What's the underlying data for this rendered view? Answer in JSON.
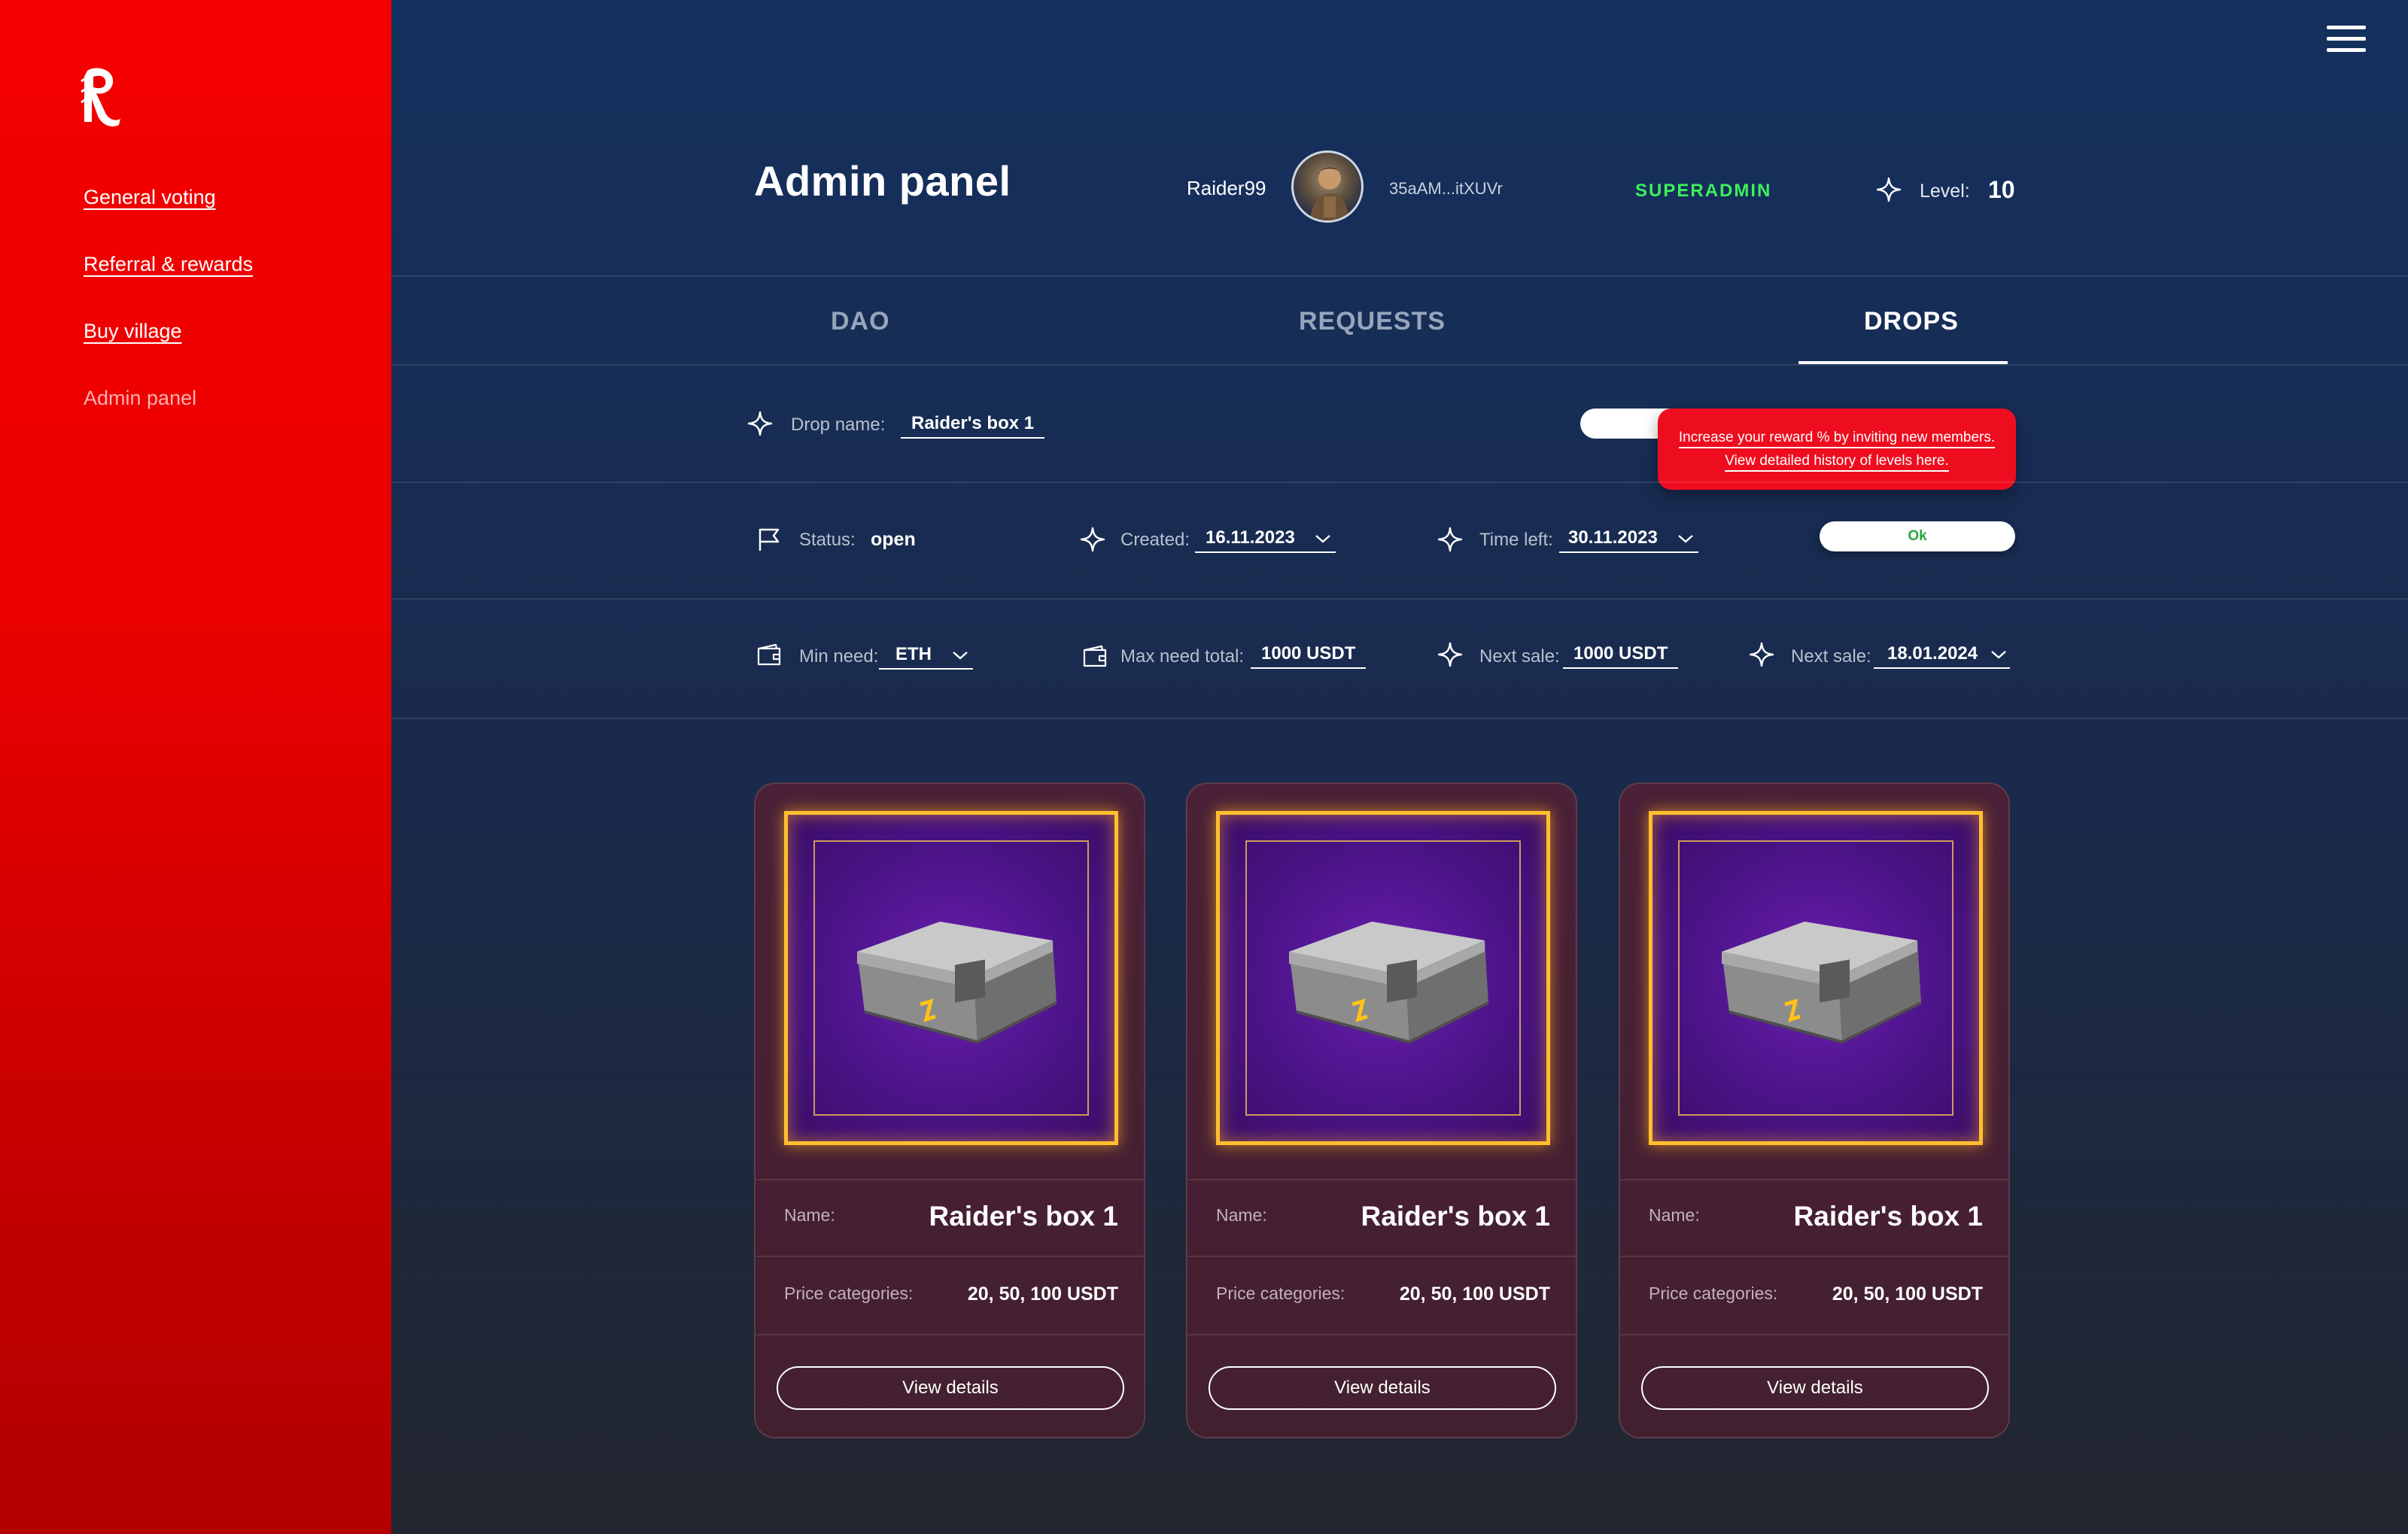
{
  "sidebar": {
    "logo": "raider-logo",
    "items": [
      {
        "label": "General voting"
      },
      {
        "label": "Referral & rewards"
      },
      {
        "label": "Buy village"
      },
      {
        "label": "Admin panel"
      }
    ]
  },
  "header": {
    "title": "Admin panel",
    "username": "Raider99",
    "wallet": "35aAM...itXUVr",
    "role": "SUPERADMIN",
    "level_label": "Level:",
    "level_value": "10"
  },
  "tabs": [
    {
      "label": "DAO"
    },
    {
      "label": "REQUESTS"
    },
    {
      "label": "DROPS",
      "active": true
    }
  ],
  "form": {
    "drop_name_label": "Drop name:",
    "drop_name_value": "Raider's box 1",
    "tooltip": "Increase your reward % by inviting new members. View detailed history of levels here.",
    "status_label": "Status:",
    "status_value": "open",
    "created_label": "Created:",
    "created_value": "16.11.2023",
    "time_left_label": "Time left:",
    "time_left_value": "30.11.2023",
    "ok_label": "Ok",
    "min_need_label": "Min need:",
    "min_need_value": "ETH",
    "max_need_label": "Max need total:",
    "max_need_value": "1000 USDT",
    "next_sale_label": "Next sale:",
    "next_sale_value": "1000 USDT",
    "next_sale_date_label": "Next sale:",
    "next_sale_date_value": "18.01.2024"
  },
  "cards": [
    {
      "name_label": "Name:",
      "name": "Raider's box 1",
      "price_label": "Price categories:",
      "price": "20, 50, 100 USDT",
      "button": "View details"
    },
    {
      "name_label": "Name:",
      "name": "Raider's box 1",
      "price_label": "Price categories:",
      "price": "20, 50, 100 USDT",
      "button": "View details"
    },
    {
      "name_label": "Name:",
      "name": "Raider's box 1",
      "price_label": "Price categories:",
      "price": "20, 50, 100 USDT",
      "button": "View details"
    }
  ],
  "colors": {
    "sidebar": "#f50000",
    "accent_green": "#3df05a",
    "tooltip": "#ee0d1e",
    "card_frame": "#ffbf2e"
  }
}
